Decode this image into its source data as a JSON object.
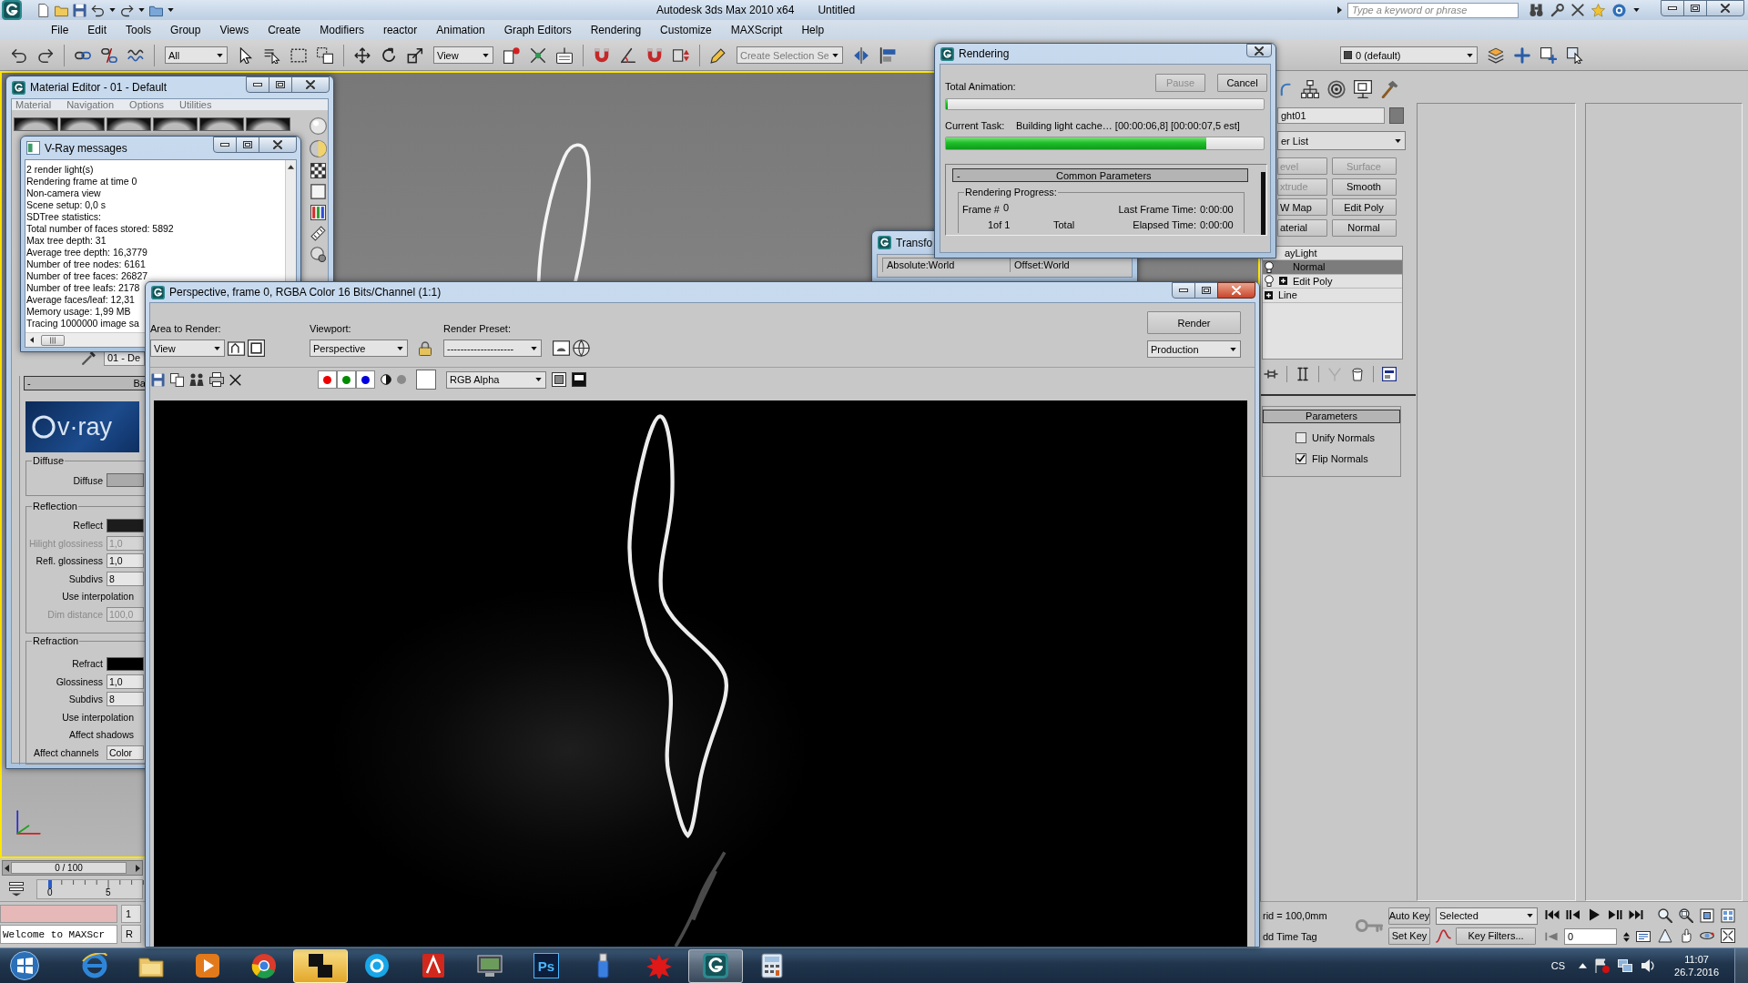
{
  "window": {
    "title": "Autodesk 3ds Max 2010 x64",
    "document": "Untitled",
    "search": {
      "placeholder": "Type a keyword or phrase"
    }
  },
  "menu": [
    "File",
    "Edit",
    "Tools",
    "Group",
    "Views",
    "Create",
    "Modifiers",
    "reactor",
    "Animation",
    "Graph Editors",
    "Rendering",
    "Customize",
    "MAXScript",
    "Help"
  ],
  "toolbar": {
    "selection_filter": "All",
    "reference_coordinate_system": "View",
    "named_selection": {
      "placeholder": "Create Selection Se"
    },
    "layer": "0 (default)"
  },
  "viewport": {
    "active": true
  },
  "material_editor": {
    "title": "Material Editor - 01 - Default",
    "menu": [
      "Material",
      "Navigation",
      "Options",
      "Utilities"
    ],
    "material_name": "01 - De",
    "rollout": {
      "collapse": "-",
      "title": "Ba"
    },
    "logo": "v·ray",
    "groups": [
      {
        "title": "Diffuse",
        "rows": [
          {
            "kind": "swatch",
            "label": "Diffuse",
            "color": "#aaaaaa",
            "disabled": false
          }
        ]
      },
      {
        "title": "Reflection",
        "rows": [
          {
            "kind": "swatch",
            "label": "Reflect",
            "color": "#1c1c1c",
            "disabled": false
          },
          {
            "kind": "spinner",
            "label": "Hilight glossiness",
            "value": "1,0",
            "disabled": true
          },
          {
            "kind": "spinner",
            "label": "Refl. glossiness",
            "value": "1,0",
            "disabled": false
          },
          {
            "kind": "spinner",
            "label": "Subdivs",
            "value": "8",
            "disabled": false
          },
          {
            "kind": "option",
            "label": "Use interpolation",
            "disabled": false
          },
          {
            "kind": "spinner",
            "label": "Dim distance",
            "value": "100,0",
            "disabled": true
          }
        ]
      },
      {
        "title": "Refraction",
        "rows": [
          {
            "kind": "swatch",
            "label": "Refract",
            "color": "#000000",
            "disabled": false
          },
          {
            "kind": "spinner",
            "label": "Glossiness",
            "value": "1,0",
            "disabled": false
          },
          {
            "kind": "spinner",
            "label": "Subdivs",
            "value": "8",
            "disabled": false
          },
          {
            "kind": "option",
            "label": "Use interpolation",
            "disabled": false
          },
          {
            "kind": "option",
            "label": "Affect shadows",
            "disabled": false
          },
          {
            "kind": "dropdown",
            "label": "Affect channels",
            "value": "Color",
            "disabled": false
          }
        ]
      }
    ]
  },
  "vray_messages": {
    "title": "V-Ray messages",
    "lines": [
      "2 render light(s)",
      "Rendering frame at time 0",
      "Non-camera view",
      "Scene setup: 0,0 s",
      "SDTree statistics:",
      "Total number of faces stored: 5892",
      "Max tree depth: 31",
      "Average tree depth: 16,3779",
      "Number of tree nodes: 6161",
      "Number of tree faces: 26827",
      "Number of tree leafs: 2178",
      "Average faces/leaf: 12,31",
      "Memory usage: 1,99 MB",
      "Tracing 1000000 image sa"
    ]
  },
  "transform_window": {
    "title": "Transfo",
    "absolute": "Absolute:World",
    "offset": "Offset:World"
  },
  "render_frame": {
    "title": "Perspective, frame 0, RGBA Color 16 Bits/Channel (1:1)",
    "area_label": "Area to Render:",
    "area": "View",
    "viewport_label": "Viewport:",
    "viewport": "Perspective",
    "preset_label": "Render Preset:",
    "preset": "--------------------",
    "render_button": "Render",
    "render_mode": "Production",
    "channels": [
      {
        "color": "#ee0000"
      },
      {
        "color": "#008c00"
      },
      {
        "color": "#0000dd"
      }
    ],
    "display_channel": "RGB Alpha"
  },
  "rendering_dialog": {
    "title": "Rendering",
    "total_animation": {
      "label": "Total Animation:",
      "level": 0
    },
    "pause": {
      "label": "Pause",
      "disabled": true
    },
    "cancel": {
      "label": "Cancel",
      "disabled": false
    },
    "current_task": {
      "label": "Current Task:",
      "text": "Building light cache… [00:00:06,8] [00:00:07,5 est]",
      "level": 0.82
    },
    "rollout": {
      "collapse": "-",
      "title": "Common Parameters",
      "group": "Rendering Progress:",
      "frame_label": "Frame #",
      "frame": "0",
      "count": "1of 1",
      "total": "Total",
      "last_frame_label": "Last Frame Time:",
      "last_frame": "0:00:00",
      "elapsed_label": "Elapsed Time:",
      "elapsed": "0:00:00"
    }
  },
  "command_panel": {
    "object_name": "ght01",
    "modifier_list": "er List",
    "modifier_buttons": [
      {
        "label": "evel",
        "disabled": true
      },
      {
        "label": "Surface",
        "disabled": true
      },
      {
        "label": "xtrude",
        "disabled": true
      },
      {
        "label": "Smooth",
        "disabled": false
      },
      {
        "label": "W Map",
        "disabled": false
      },
      {
        "label": "Edit Poly",
        "disabled": false
      },
      {
        "label": "aterial",
        "disabled": false
      },
      {
        "label": "Normal",
        "disabled": false
      }
    ],
    "stack": [
      {
        "kind": "object",
        "label": "ayLight",
        "selected": false,
        "bulb": false,
        "expander": false
      },
      {
        "kind": "modifier",
        "label": "Normal",
        "selected": true,
        "bulb": true,
        "expander": false
      },
      {
        "kind": "modifier",
        "label": "Edit Poly",
        "selected": false,
        "bulb": true,
        "expander": true
      },
      {
        "kind": "modifier",
        "label": "Line",
        "selected": false,
        "bulb": false,
        "expander": true
      }
    ],
    "parameters": {
      "title": "Parameters",
      "options": [
        {
          "label": "Unify Normals",
          "checked": false
        },
        {
          "label": "Flip Normals",
          "checked": true
        }
      ]
    }
  },
  "timeline": {
    "frame_counter": "0 / 100",
    "ticks": [
      "0",
      "5"
    ]
  },
  "status_bar": {
    "selection": "1",
    "prompt": "R",
    "maxscript": "Welcome to MAXScr",
    "grid": "rid = 100,0mm",
    "time_tag": "dd Time Tag",
    "auto_key": "Auto Key",
    "set_key": "Set Key",
    "key_mode": "Selected",
    "key_filters": "Key Filters...",
    "frame": "0"
  },
  "taskbar": {
    "apps": [
      {
        "kind": "ie",
        "active": false,
        "flashing": false
      },
      {
        "kind": "folder",
        "active": false,
        "flashing": false
      },
      {
        "kind": "player",
        "active": false,
        "flashing": false
      },
      {
        "kind": "chrome",
        "active": false,
        "flashing": false
      },
      {
        "kind": "tiles",
        "active": false,
        "flashing": true
      },
      {
        "kind": "skype",
        "active": false,
        "flashing": false
      },
      {
        "kind": "acrobat",
        "active": false,
        "flashing": false
      },
      {
        "kind": "monitor",
        "active": false,
        "flashing": false
      },
      {
        "kind": "photoshop",
        "label": "Ps",
        "active": false,
        "flashing": false
      },
      {
        "kind": "usb",
        "active": false,
        "flashing": false
      },
      {
        "kind": "splat",
        "active": false,
        "flashing": false
      },
      {
        "kind": "max",
        "active": true,
        "flashing": false
      },
      {
        "kind": "calculator",
        "active": false,
        "flashing": false
      }
    ],
    "tray": {
      "language": "CS",
      "time": "11:07",
      "date": "26.7.2016"
    }
  }
}
